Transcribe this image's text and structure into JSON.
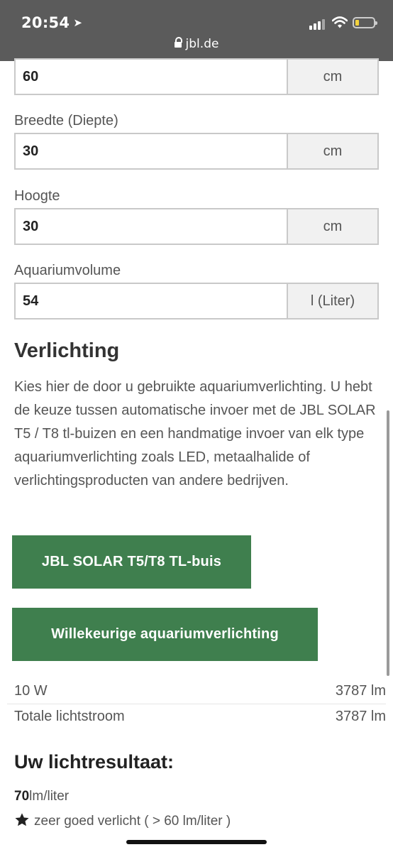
{
  "status_bar": {
    "time": "20:54",
    "url": "jbl.de"
  },
  "fields": [
    {
      "label": "",
      "value": "60",
      "unit": "cm"
    },
    {
      "label": "Breedte (Diepte)",
      "value": "30",
      "unit": "cm"
    },
    {
      "label": "Hoogte",
      "value": "30",
      "unit": "cm"
    },
    {
      "label": "Aquariumvolume",
      "value": "54",
      "unit": "l (Liter)"
    }
  ],
  "lighting": {
    "title": "Verlichting",
    "description": "Kies hier de door u gebruikte aquariumverlichting. U hebt de keuze tussen automatische invoer met de JBL SOLAR T5 / T8 tl-buizen en een handmatige invoer van elk type aquariumverlichting zoals LED, metaalhalide of verlichtingsproducten van andere bedrijven.",
    "button_tl": "JBL SOLAR T5/T8 TL-buis",
    "button_custom": "Willekeurige aquariumverlichting"
  },
  "summary": [
    {
      "label": "10 W",
      "value": "3787 lm"
    },
    {
      "label": "Totale lichtstroom",
      "value": "3787 lm"
    }
  ],
  "result": {
    "title": "Uw lichtresultaat:",
    "lm_value": "70",
    "lm_unit": "lm/liter",
    "rating_text": "zeer goed verlicht ( > 60 lm/liter )"
  },
  "icons": {
    "lock": "lock-icon",
    "location": "location-arrow-icon",
    "signal": "cellular-signal-icon",
    "wifi": "wifi-icon",
    "battery": "battery-icon",
    "star": "star-icon"
  },
  "colors": {
    "button_green": "#3f7f4e",
    "statusbar_bg": "#5b5b5b"
  }
}
